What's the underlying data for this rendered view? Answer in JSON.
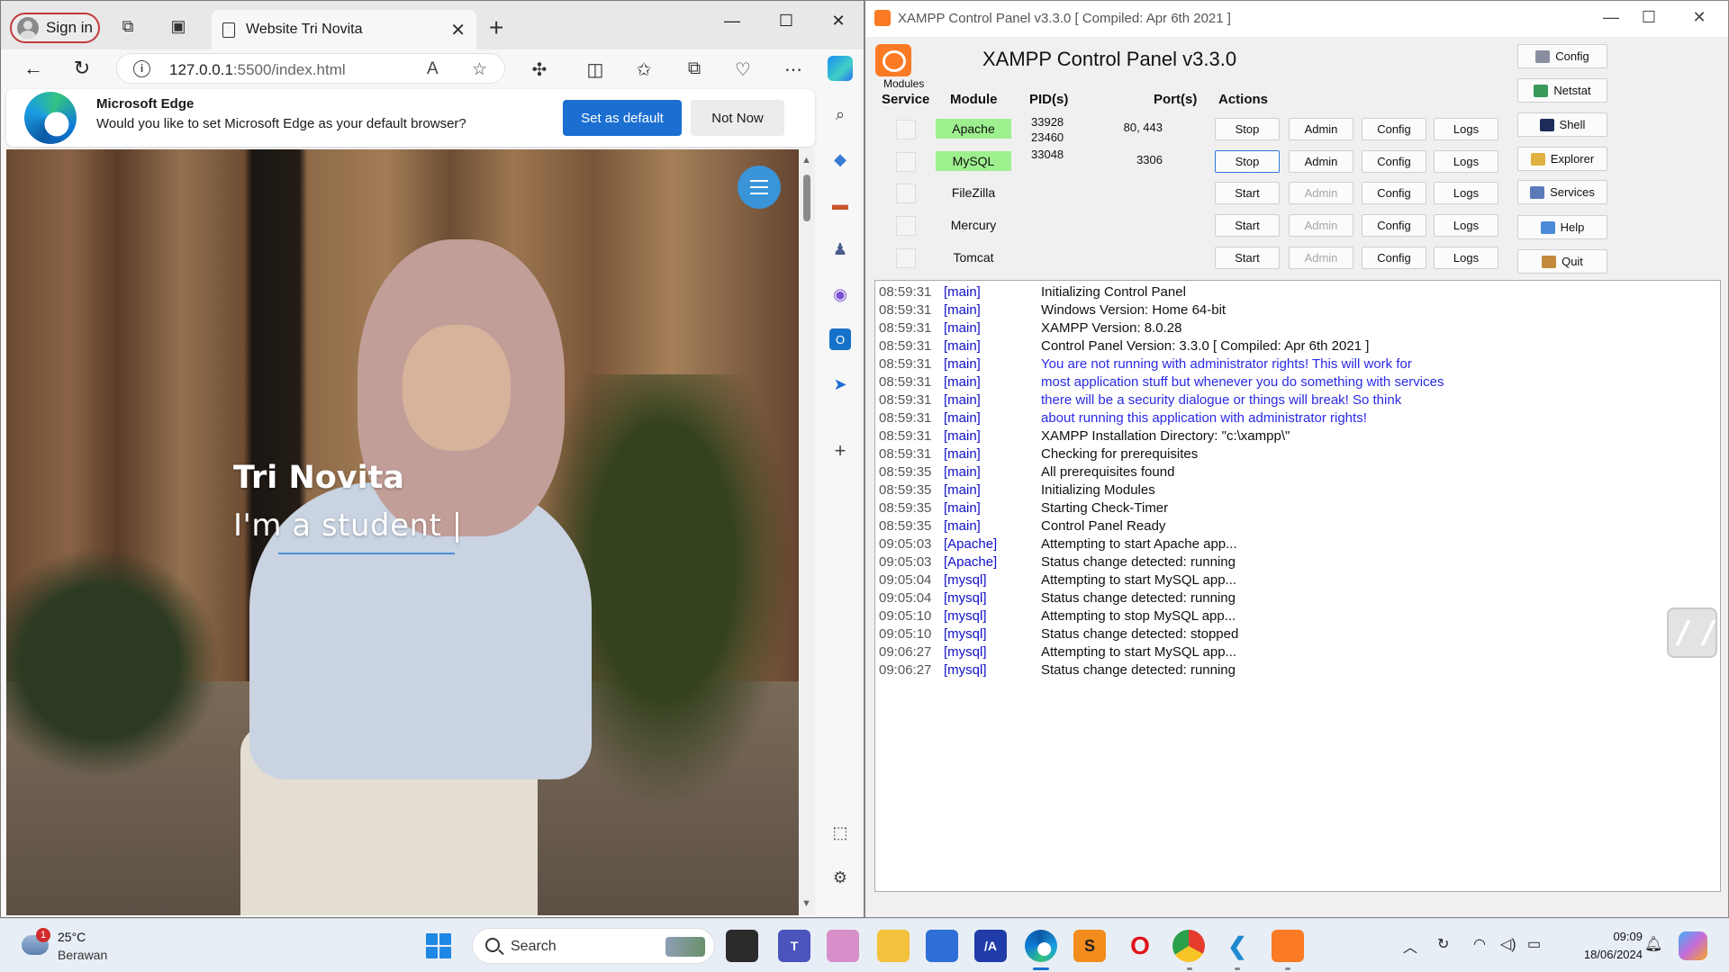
{
  "edge": {
    "signin_label": "Sign in",
    "tab_title": "Website Tri Novita",
    "address": {
      "host": "127.0.0.1",
      "path": ":5500/index.html"
    },
    "banner": {
      "title": "Microsoft Edge",
      "message": "Would you like to set Microsoft Edge as your default browser?",
      "set_default": "Set as default",
      "not_now": "Not Now"
    },
    "page": {
      "name": "Tri Novita",
      "subtitle": "I'm a student |"
    }
  },
  "xampp": {
    "window_title": "XAMPP Control Panel v3.3.0   [ Compiled: Apr 6th 2021 ]",
    "heading": "XAMPP Control Panel v3.3.0",
    "modules_label": "Modules",
    "columns": {
      "service": "Service",
      "module": "Module",
      "pids": "PID(s)",
      "ports": "Port(s)",
      "actions": "Actions"
    },
    "modules": [
      {
        "name": "Apache",
        "running": true,
        "pid_line1": "33928",
        "pid_line2": "23460",
        "ports": "80, 443",
        "action": "Stop",
        "admin": "Admin",
        "config": "Config",
        "logs": "Logs"
      },
      {
        "name": "MySQL",
        "running": true,
        "pid_line1": "33048",
        "pid_line2": "",
        "ports": "3306",
        "action": "Stop",
        "admin": "Admin",
        "config": "Config",
        "logs": "Logs"
      },
      {
        "name": "FileZilla",
        "running": false,
        "pid_line1": "",
        "pid_line2": "",
        "ports": "",
        "action": "Start",
        "admin": "Admin",
        "config": "Config",
        "logs": "Logs"
      },
      {
        "name": "Mercury",
        "running": false,
        "pid_line1": "",
        "pid_line2": "",
        "ports": "",
        "action": "Start",
        "admin": "Admin",
        "config": "Config",
        "logs": "Logs"
      },
      {
        "name": "Tomcat",
        "running": false,
        "pid_line1": "",
        "pid_line2": "",
        "ports": "",
        "action": "Start",
        "admin": "Admin",
        "config": "Config",
        "logs": "Logs"
      }
    ],
    "side_buttons": [
      "Config",
      "Netstat",
      "Shell",
      "Explorer",
      "Services",
      "Help",
      "Quit"
    ],
    "log": [
      {
        "time": "08:59:31",
        "module": "[main]",
        "text": "Initializing Control Panel",
        "warn": false
      },
      {
        "time": "08:59:31",
        "module": "[main]",
        "text": "Windows Version:  Home  64-bit",
        "warn": false
      },
      {
        "time": "08:59:31",
        "module": "[main]",
        "text": "XAMPP Version: 8.0.28",
        "warn": false
      },
      {
        "time": "08:59:31",
        "module": "[main]",
        "text": "Control Panel Version: 3.3.0  [ Compiled: Apr 6th 2021 ]",
        "warn": false
      },
      {
        "time": "08:59:31",
        "module": "[main]",
        "text": "You are not running with administrator rights! This will work for",
        "warn": true
      },
      {
        "time": "08:59:31",
        "module": "[main]",
        "text": "most application stuff but whenever you do something with services",
        "warn": true
      },
      {
        "time": "08:59:31",
        "module": "[main]",
        "text": "there will be a security dialogue or things will break! So think",
        "warn": true
      },
      {
        "time": "08:59:31",
        "module": "[main]",
        "text": "about running this application with administrator rights!",
        "warn": true
      },
      {
        "time": "08:59:31",
        "module": "[main]",
        "text": "XAMPP Installation Directory: \"c:\\xampp\\\"",
        "warn": false
      },
      {
        "time": "08:59:31",
        "module": "[main]",
        "text": "Checking for prerequisites",
        "warn": false
      },
      {
        "time": "08:59:35",
        "module": "[main]",
        "text": "All prerequisites found",
        "warn": false
      },
      {
        "time": "08:59:35",
        "module": "[main]",
        "text": "Initializing Modules",
        "warn": false
      },
      {
        "time": "08:59:35",
        "module": "[main]",
        "text": "Starting Check-Timer",
        "warn": false
      },
      {
        "time": "08:59:35",
        "module": "[main]",
        "text": "Control Panel Ready",
        "warn": false
      },
      {
        "time": "09:05:03",
        "module": "[Apache]",
        "text": "Attempting to start Apache app...",
        "warn": false
      },
      {
        "time": "09:05:03",
        "module": "[Apache]",
        "text": "Status change detected: running",
        "warn": false
      },
      {
        "time": "09:05:04",
        "module": "[mysql]",
        "text": "Attempting to start MySQL app...",
        "warn": false
      },
      {
        "time": "09:05:04",
        "module": "[mysql]",
        "text": "Status change detected: running",
        "warn": false
      },
      {
        "time": "09:05:10",
        "module": "[mysql]",
        "text": "Attempting to stop MySQL app...",
        "warn": false
      },
      {
        "time": "09:05:10",
        "module": "[mysql]",
        "text": "Status change detected: stopped",
        "warn": false
      },
      {
        "time": "09:06:27",
        "module": "[mysql]",
        "text": "Attempting to start MySQL app...",
        "warn": false
      },
      {
        "time": "09:06:27",
        "module": "[mysql]",
        "text": "Status change detected: running",
        "warn": false
      }
    ]
  },
  "taskbar": {
    "weather": {
      "badge": "1",
      "temp": "25°C",
      "desc": "Berawan"
    },
    "search_label": "Search",
    "time": "09:09",
    "date": "18/06/2024"
  },
  "colors": {
    "running_green": "#9ef08f",
    "edge_blue": "#1b6fd1",
    "xampp_orange": "#fb7a24",
    "log_module_blue": "#1010c8"
  }
}
